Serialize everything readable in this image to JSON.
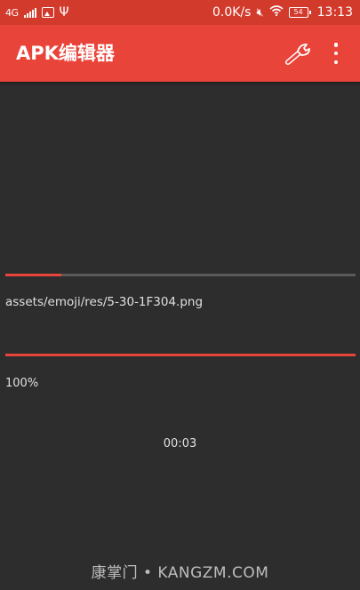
{
  "status_bar": {
    "network": "4G",
    "speed": "0.0K/s",
    "battery": "54",
    "time": "13:13",
    "icons": [
      "signal-icon",
      "image-icon",
      "usb-icon",
      "mute-icon",
      "wifi-icon",
      "battery-icon"
    ]
  },
  "app_bar": {
    "title": "APK编辑器",
    "actions": [
      "wrench-icon",
      "more-vert-icon"
    ]
  },
  "progress": {
    "file_fraction": 0.16,
    "current_file": "assets/emoji/res/5-30-1F304.png",
    "overall_fraction": 1.0,
    "percent_label": "100%",
    "elapsed": "00:03"
  },
  "watermark": "康掌门 • KANGZM.COM",
  "colors": {
    "accent": "#e9443a",
    "status_bar": "#d23a2c",
    "background": "#2d2d2d",
    "track": "#5a5a5a"
  }
}
